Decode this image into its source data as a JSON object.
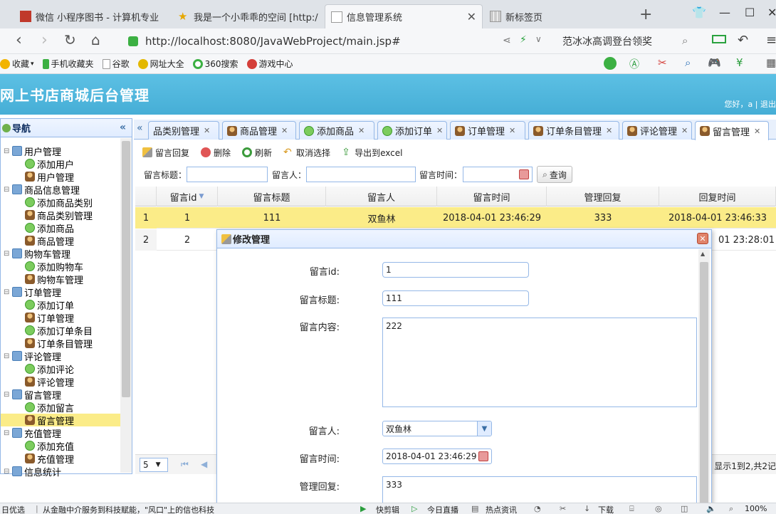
{
  "browser": {
    "tabs": [
      {
        "label": "微信 小程序图书 - 计算机专业"
      },
      {
        "label": "我是一个小乖乖的空间 [http:/"
      },
      {
        "label": "信息管理系统"
      },
      {
        "label": "新标签页"
      }
    ],
    "url": "http://localhost:8080/JavaWebProject/main.jsp#",
    "search_text": "范冰冰高调登台领奖",
    "bookmarks": [
      "收藏",
      "手机收藏夹",
      "谷歌",
      "网址大全",
      "360搜索",
      "游戏中心"
    ]
  },
  "app": {
    "title": "网上书店商城后台管理",
    "greeting": "您好，a | 退出"
  },
  "nav": {
    "title": "导航",
    "tree": [
      {
        "label": "用户管理",
        "level": 1,
        "icon": "folder"
      },
      {
        "label": "添加用户",
        "level": 2,
        "icon": "add"
      },
      {
        "label": "用户管理",
        "level": 2,
        "icon": "user"
      },
      {
        "label": "商品信息管理",
        "level": 1,
        "icon": "folder"
      },
      {
        "label": "添加商品类别",
        "level": 2,
        "icon": "add"
      },
      {
        "label": "商品类别管理",
        "level": 2,
        "icon": "user"
      },
      {
        "label": "添加商品",
        "level": 2,
        "icon": "add"
      },
      {
        "label": "商品管理",
        "level": 2,
        "icon": "user"
      },
      {
        "label": "购物车管理",
        "level": 1,
        "icon": "folder"
      },
      {
        "label": "添加购物车",
        "level": 2,
        "icon": "add"
      },
      {
        "label": "购物车管理",
        "level": 2,
        "icon": "user"
      },
      {
        "label": "订单管理",
        "level": 1,
        "icon": "folder"
      },
      {
        "label": "添加订单",
        "level": 2,
        "icon": "add"
      },
      {
        "label": "订单管理",
        "level": 2,
        "icon": "user"
      },
      {
        "label": "添加订单条目",
        "level": 2,
        "icon": "add"
      },
      {
        "label": "订单条目管理",
        "level": 2,
        "icon": "user"
      },
      {
        "label": "评论管理",
        "level": 1,
        "icon": "folder"
      },
      {
        "label": "添加评论",
        "level": 2,
        "icon": "add"
      },
      {
        "label": "评论管理",
        "level": 2,
        "icon": "user"
      },
      {
        "label": "留言管理",
        "level": 1,
        "icon": "folder"
      },
      {
        "label": "添加留言",
        "level": 2,
        "icon": "add"
      },
      {
        "label": "留言管理",
        "level": 2,
        "icon": "user",
        "selected": true
      },
      {
        "label": "充值管理",
        "level": 1,
        "icon": "folder"
      },
      {
        "label": "添加充值",
        "level": 2,
        "icon": "add"
      },
      {
        "label": "充值管理",
        "level": 2,
        "icon": "user"
      },
      {
        "label": "信息统计",
        "level": 1,
        "icon": "folder"
      }
    ]
  },
  "tabs": [
    {
      "label": "品类别管理",
      "icon": "none"
    },
    {
      "label": "商品管理",
      "icon": "user"
    },
    {
      "label": "添加商品",
      "icon": "add"
    },
    {
      "label": "添加订单",
      "icon": "add"
    },
    {
      "label": "订单管理",
      "icon": "user"
    },
    {
      "label": "订单条目管理",
      "icon": "user"
    },
    {
      "label": "评论管理",
      "icon": "user"
    },
    {
      "label": "留言管理",
      "icon": "user",
      "active": true
    }
  ],
  "toolbar": {
    "reply": "留言回复",
    "delete": "删除",
    "refresh": "刷新",
    "cancel": "取消选择",
    "export": "导出到excel"
  },
  "search": {
    "title_label": "留言标题：",
    "user_label": "留言人：",
    "time_label": "留言时间：",
    "query": "查询"
  },
  "grid": {
    "columns": [
      "留言id",
      "留言标题",
      "留言人",
      "留言时间",
      "管理回复",
      "回复时间"
    ],
    "rows": [
      {
        "num": "1",
        "cells": [
          "1",
          "111",
          "双鱼林",
          "2018-04-01 23:46:29",
          "333",
          "2018-04-01 23:46:33"
        ]
      },
      {
        "num": "2",
        "cells": [
          "2",
          "",
          "",
          "",
          "",
          "01 23:28:01"
        ]
      }
    ]
  },
  "pager": {
    "page_size": "5",
    "info": "显示1到2,共2记"
  },
  "dialog": {
    "title": "修改管理",
    "fields": {
      "id_label": "留言id:",
      "id_value": "1",
      "title_label": "留言标题:",
      "title_value": "111",
      "content_label": "留言内容:",
      "content_value": "222",
      "user_label": "留言人:",
      "user_value": "双鱼林",
      "time_label": "留言时间:",
      "time_value": "2018-04-01 23:46:29",
      "reply_label": "管理回复:",
      "reply_value": "333"
    }
  },
  "statusbar": {
    "left": "日优选",
    "news": "从金融中介服务到科技赋能，\"风口\"上的信也科技",
    "items": [
      "快剪辑",
      "今日直播",
      "热点资讯"
    ],
    "download": "下载",
    "zoom": "100%"
  }
}
